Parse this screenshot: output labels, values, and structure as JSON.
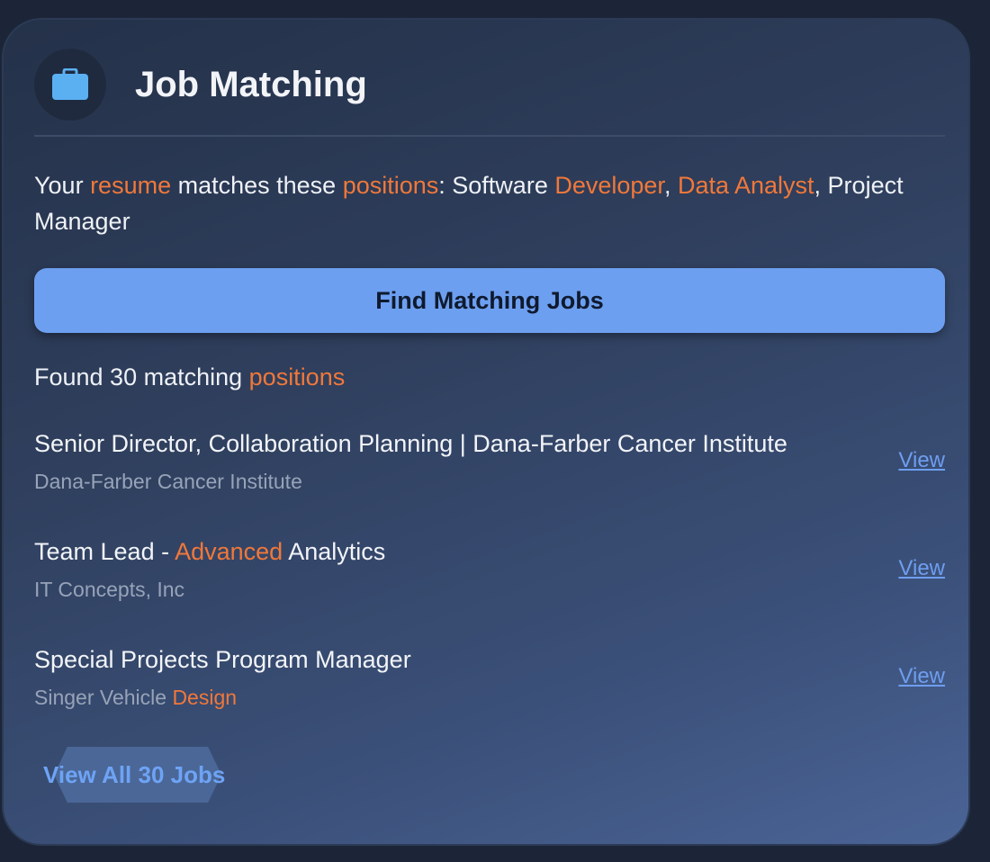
{
  "header": {
    "title": "Job Matching",
    "icon": "briefcase-icon",
    "icon_color": "#5bb0f2"
  },
  "summary": {
    "p1": "Your ",
    "p2": "resume",
    "p3": " matches these ",
    "p4": "positions",
    "p5": ": Software ",
    "p6": "Developer",
    "p7": ", ",
    "p8": "Data Analyst",
    "p9": ", Project Manager"
  },
  "find_button": {
    "label": "Find Matching Jobs"
  },
  "results": {
    "found_prefix": "Found 30 matching ",
    "found_highlight": "positions"
  },
  "jobs": [
    {
      "title": "Senior Director, Collaboration Planning | Dana-Farber Cancer Institute",
      "company": "Dana-Farber Cancer Institute",
      "link": "View"
    },
    {
      "title_a": "Team Lead - ",
      "title_hl": "Advanced",
      "title_b": " Analytics",
      "company": "IT Concepts, Inc",
      "link": "View"
    },
    {
      "title": "Special Projects Program Manager",
      "company_a": "Singer Vehicle ",
      "company_hl": "Design",
      "link": "View"
    }
  ],
  "view_all": {
    "label": "View All 30 Jobs"
  },
  "colors": {
    "accent": "#f0783a",
    "link": "#6e9ef0",
    "button": "#6d9ff0"
  }
}
